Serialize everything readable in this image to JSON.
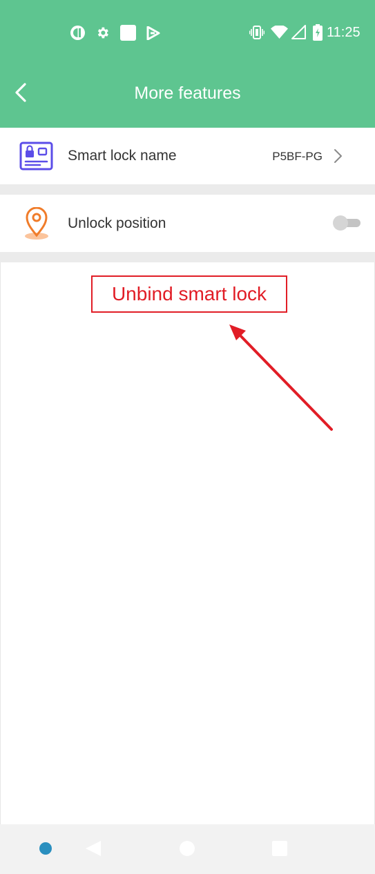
{
  "status_bar": {
    "time": "11:25",
    "left_icons": [
      "app-circle-icon",
      "settings-gear-icon",
      "square-app-icon",
      "play-store-icon"
    ],
    "right_icons": [
      "vibrate-icon",
      "wifi-icon",
      "signal-icon",
      "battery-charging-icon"
    ]
  },
  "app_bar": {
    "title": "More features",
    "back_icon": "chevron-left-icon"
  },
  "settings": [
    {
      "label": "Smart lock name",
      "value": "P5BF-PG",
      "icon": "id-card-lock-icon",
      "trailing": "chevron-right-icon"
    },
    {
      "label": "Unlock position",
      "icon": "location-pin-icon",
      "toggle_on": false
    }
  ],
  "unbind_button": {
    "label": "Unbind smart lock"
  },
  "colors": {
    "header_green": "#5ec590",
    "annotation_red": "#e11d26",
    "card_icon_purple": "#5b4de8",
    "pin_orange": "#f07c2a",
    "nav_dot_blue": "#2a8fbf"
  },
  "nav_bar": {
    "icons": [
      "assistant-dot-icon",
      "nav-back-icon",
      "nav-home-icon",
      "nav-recents-icon"
    ]
  }
}
